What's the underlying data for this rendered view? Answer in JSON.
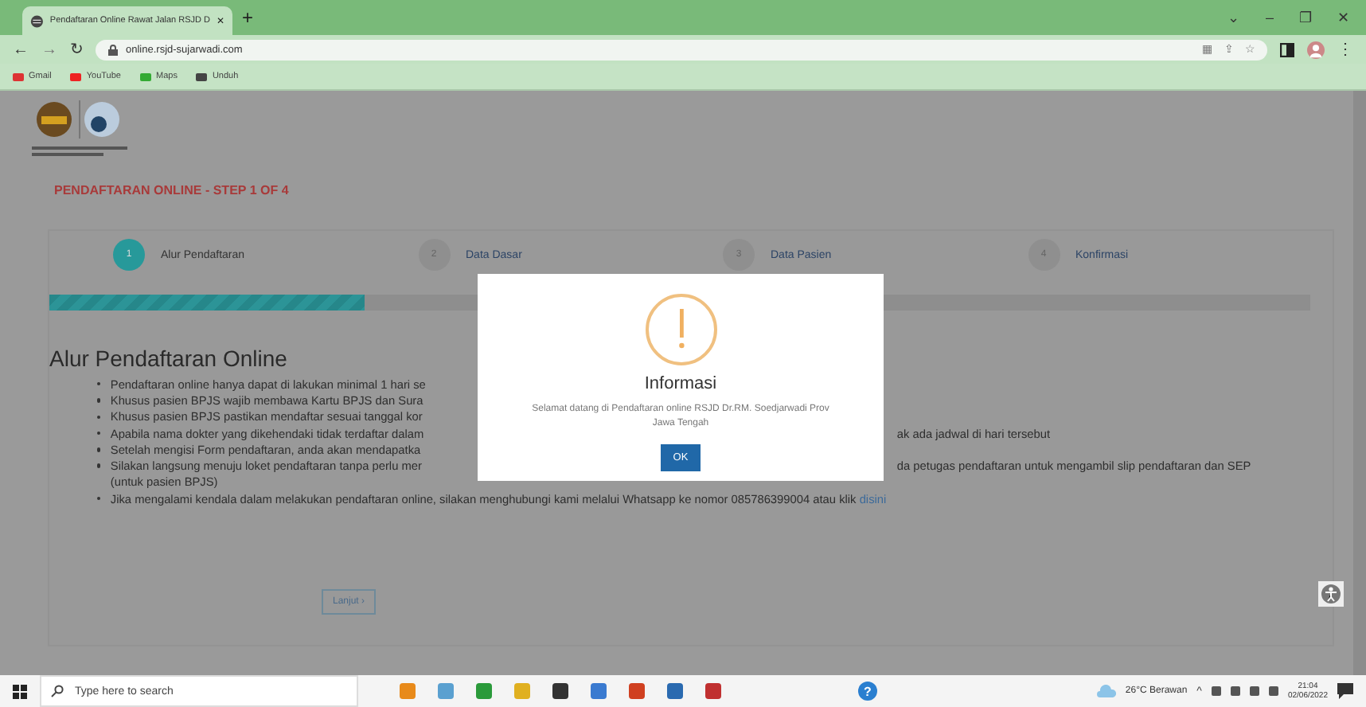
{
  "browser": {
    "tab_title": "Pendaftaran Online Rawat Jalan RSJD D",
    "tab_close": "✕",
    "new_tab": "+",
    "window_controls": [
      "⌄",
      "–",
      "❐",
      "✕"
    ],
    "nav": [
      "←",
      "→",
      "↻"
    ],
    "address_icons": [
      "▦",
      "⇪",
      "☆"
    ],
    "menu": "⋮",
    "url": "online.rsjd-sujarwadi.com",
    "bookmarks": [
      "Gmail",
      "YouTube",
      "Maps",
      "Unduh"
    ]
  },
  "page": {
    "title": "PENDAFTARAN ONLINE - STEP 1 OF 4",
    "steps": [
      {
        "number": "1",
        "label": "Alur Pendaftaran",
        "selected": true
      },
      {
        "number": "2",
        "label": "Data Dasar",
        "selected": false
      },
      {
        "number": "3",
        "label": "Data Pasien",
        "selected": false
      },
      {
        "number": "4",
        "label": "Konfirmasi",
        "selected": false
      }
    ],
    "progress": {
      "level": 0.25
    },
    "heading": "Alur Pendaftaran Online",
    "items": [
      {
        "kind": "split",
        "text_left": "Pendaftaran online hanya dapat di lakukan minimal 1 hari se"
      },
      {
        "kind": "split",
        "text_left": "Khusus pasien BPJS wajib membawa Kartu BPJS dan Sura"
      },
      {
        "kind": "split",
        "text_left": "Khusus pasien BPJS pastikan mendaftar sesuai tanggal kor"
      },
      {
        "kind": "split",
        "text_left": "Apabila nama dokter yang dikehendaki tidak terdaftar dalam",
        "text_right": "ak ada jadwal di hari tersebut"
      },
      {
        "kind": "split",
        "text_left": "Setelah mengisi Form pendaftaran, anda akan mendapatka"
      },
      {
        "kind": "split",
        "text_left": "Silakan langsung menuju loket pendaftaran tanpa perlu mer",
        "text_right": "da petugas pendaftaran untuk mengambil slip pendaftaran dan SEP",
        "text_next": "(untuk pasien BPJS)"
      },
      {
        "kind": "full",
        "text": "Jika mengalami kendala dalam melakukan pendaftaran online, silakan menghubungi kami melalui Whatsapp ke nomor 085786399004 atau klik",
        "link": "disini"
      }
    ],
    "next_button": "Lanjut ›"
  },
  "dialog": {
    "title": "Informasi",
    "message": "Selamat datang di Pendaftaran online RSJD Dr.RM. Soedjarwadi Prov Jawa Tengah",
    "button": "OK"
  },
  "taskbar": {
    "help": "?",
    "tray_caret": "^",
    "search_placeholder": "Type here to search",
    "weather": "26°C Berawan",
    "time": "21:04",
    "date": "02/06/2022"
  }
}
